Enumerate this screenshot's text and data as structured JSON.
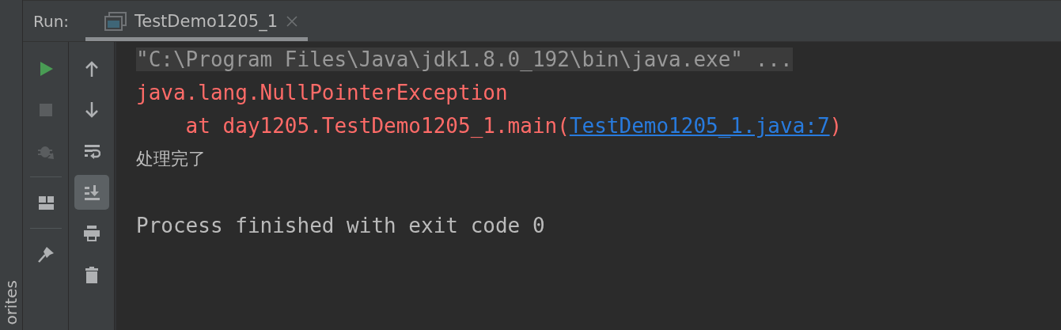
{
  "side_strip": {
    "label": "orites"
  },
  "header": {
    "label": "Run:",
    "tabs": [
      {
        "title": "TestDemo1205_1",
        "selected": true
      }
    ]
  },
  "toolbar_left": [
    {
      "kind": "run",
      "disabled": false
    },
    {
      "kind": "stop",
      "disabled": true
    },
    {
      "kind": "debug",
      "disabled": true
    },
    {
      "kind": "separator"
    },
    {
      "kind": "layout",
      "disabled": false
    },
    {
      "kind": "separator"
    },
    {
      "kind": "pin",
      "disabled": false
    }
  ],
  "toolbar_right": [
    {
      "kind": "up",
      "selected": false
    },
    {
      "kind": "down",
      "selected": false
    },
    {
      "kind": "wrap",
      "selected": false
    },
    {
      "kind": "scroll_end",
      "selected": true
    },
    {
      "kind": "print",
      "selected": false
    },
    {
      "kind": "trash",
      "selected": false
    }
  ],
  "console": [
    {
      "segments": [
        {
          "kind": "command",
          "text": "\"C:\\Program Files\\Java\\jdk1.8.0_192\\bin\\java.exe\" ..."
        }
      ]
    },
    {
      "segments": [
        {
          "kind": "error",
          "text": "java.lang.NullPointerException"
        }
      ]
    },
    {
      "segments": [
        {
          "kind": "error",
          "text": "    at day1205.TestDemo1205_1.main("
        },
        {
          "kind": "link",
          "text": "TestDemo1205_1.java:7"
        },
        {
          "kind": "error",
          "text": ")"
        }
      ]
    },
    {
      "segments": [
        {
          "kind": "output",
          "text": "处理完了"
        }
      ]
    },
    {
      "segments": [
        {
          "kind": "output",
          "text": "Process finished with exit code 0"
        }
      ]
    }
  ]
}
